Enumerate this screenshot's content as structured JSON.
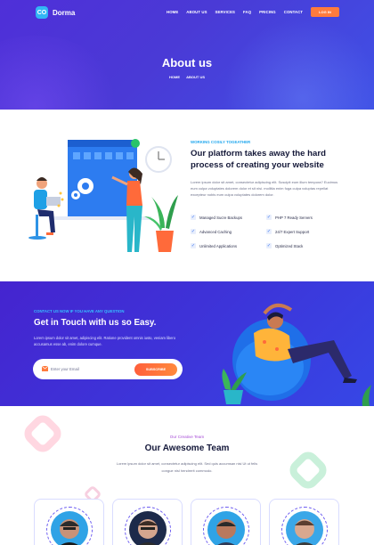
{
  "brand": {
    "logo_mark": "CO",
    "name": "Dorma"
  },
  "nav": [
    "HOME",
    "ABOUT US",
    "SERVICES",
    "FAQ",
    "PRICING",
    "CONTACT"
  ],
  "login_label": "LOG IN",
  "hero": {
    "title": "About us",
    "breadcrumb": [
      "HOME",
      "ABOUT US"
    ]
  },
  "about": {
    "eyebrow": "WORKING COSILY TOGEATHER",
    "title": "Our platform takes away the hard process of creating your website",
    "text": "Lorem ipsum dolor sit amet, consectetur adipiscing elit. Suscipit eum illum tempora? Eucimus eum culpa voluptates dolorem dolor et sit nisi. mollitia enim fuga culpa voluptas repellat excepteur nobis eum culpa voluptates dolorem dolor.",
    "features": [
      "Managed Sucre Backups",
      "PHP 7 Ready Servers",
      "Advanced Caching",
      "24/7 Expert Support",
      "Unlimited Applications",
      "Optimized Stack"
    ]
  },
  "contact": {
    "eyebrow": "CONTACT US NOW IF YOU HAVE ANY QUESTION",
    "title": "Get in Touch with us so Easy.",
    "text": "Lorem ipsum dolor sit amet, adipiscing elit. Ratione provident omnis iusto, veniam libero accusamus esse ab, enim dolore cumque.",
    "email_placeholder": "Enter your Email",
    "subscribe_label": "SUBSCRIBE"
  },
  "team": {
    "eyebrow": "Our Creative Team",
    "title": "Our Awesome Team",
    "text": "Lorem ipsum dolor sit amet, consectetur adipiscing elit. Sed quis accumsan nisi Ut ut felis congue nisl hendrerit commodo."
  },
  "colors": {
    "primary": "#4a34d9",
    "accent": "#ff7b3d",
    "cyan": "#21a7ee"
  }
}
